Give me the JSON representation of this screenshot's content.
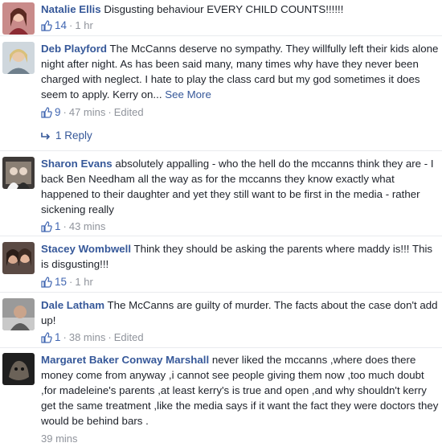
{
  "comments": [
    {
      "name": "Natalie Ellis",
      "text": "Disgusting behaviour EVERY CHILD COUNTS!!!!!!",
      "likes": "14",
      "time": "1 hr",
      "edited": ""
    },
    {
      "name": "Deb Playford",
      "text": "The McCanns deserve no sympathy. They willfully left their kids alone night after night. As has been said many, many times why have they never been charged with neglect. I hate to play the class card but my god sometimes it does seem to apply. Kerry on...",
      "see_more": "See More",
      "likes": "9",
      "time": "47 mins",
      "edited": "Edited",
      "reply_label": "1 Reply"
    },
    {
      "name": "Sharon Evans",
      "text": "absolutely appalling - who the hell do the mccanns think they are - I back Ben Needham all the way as for the mccanns they know exactly what happened to their daughter and yet they still want to be first in the media - rather sickening really",
      "likes": "1",
      "time": "43 mins",
      "edited": ""
    },
    {
      "name": "Stacey Wombwell",
      "text": "Think they should be asking the parents where maddy is!!! This is disgusting!!!",
      "likes": "15",
      "time": "1 hr",
      "edited": ""
    },
    {
      "name": "Dale Latham",
      "text": "The McCanns are guilty of murder. The facts about the case don't add up!",
      "likes": "1",
      "time": "38 mins",
      "edited": "Edited"
    },
    {
      "name": "Margaret Baker Conway Marshall",
      "text": "never liked the mccanns ,where does there money come from anyway ,i cannot see people giving them now ,too much doubt ,for madeleine's parents ,at least kerry's is true and open ,and why shouldn't kerry get the same treatment ,like the media says if it want the fact they were doctors they would be behind bars .",
      "likes": "",
      "time": "39 mins",
      "edited": ""
    }
  ],
  "colors": {
    "link": "#365899",
    "meta": "#90949c",
    "like_count": "#4267b2",
    "text": "#1d2129"
  }
}
